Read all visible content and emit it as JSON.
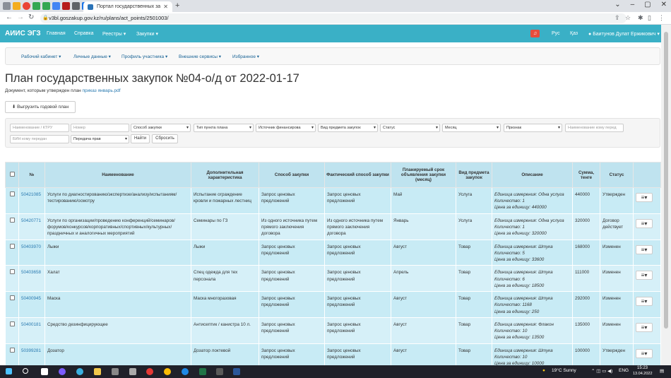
{
  "browser": {
    "tab_title": "Портал государственных закуп",
    "url": "v3bl.goszakup.gov.kz/ru/plans/act_points/2501003/"
  },
  "nav": {
    "brand": "АИИС ЭГЗ",
    "items": [
      "Главная",
      "Справка",
      "Реестры",
      "Закупки"
    ],
    "lang_ru": "Рус",
    "lang_kz": "Қаз",
    "user": "Баитунов Дулат Ержикович"
  },
  "subnav": {
    "items": [
      "Рабочий кабинет",
      "Личные данные",
      "Профиль участника",
      "Внешние сервисы",
      "Избранное"
    ]
  },
  "page": {
    "title": "План государственных закупок №04-о/д от 2022-01-17",
    "doc_label": "Документ, которым утвержден план",
    "doc_link": "приказ январь.pdf",
    "export_button": "Выгрузить годовой план"
  },
  "filters": {
    "name_placeholder": "Наименование / КТРУ",
    "number_placeholder": "Номер",
    "method": "Способ закупки",
    "point_type": "Тип пункта плана",
    "source": "Источник финансирова",
    "subject_type": "Вид предмета закупок",
    "status": "Статус",
    "month": "Месяц",
    "sign": "Признак",
    "transferred_name_placeholder": "Наименование кому перед",
    "bin_placeholder": "БИН кому передан",
    "rights_transfer": "Передача прав",
    "find_button": "Найти",
    "reset_button": "Сбросить"
  },
  "table": {
    "headers": [
      "№",
      "Наименование",
      "Дополнительная характеристика",
      "Способ закупки",
      "Фактический способ закупки",
      "Планируемый срок объявления закупки (месяц)",
      "Вид предмета закупок",
      "Описание",
      "Сумма, тенге",
      "Статус"
    ],
    "desc_labels": {
      "unit": "Единица измерения:",
      "qty": "Количество:",
      "price": "Цена за единицу:"
    },
    "rows": [
      {
        "num": "50421085",
        "name": "Услуги по диагностированию/экспертизе/анализу/испытаниям/тестированию/осмотру",
        "extra": "Испытание ограждение кровли и пожарных лестниц",
        "method": "Запрос ценовых предложений",
        "actual": "Запрос ценовых предложений",
        "month": "Май",
        "type": "Услуга",
        "unit": "Одна услуга",
        "qty": "1",
        "price": "440000",
        "sum": "440000",
        "status": "Утвержден"
      },
      {
        "num": "50420771",
        "name": "Услуги по организации/проведению конференций/семинаров/форумов/конкурсов/корпоративных/спортивных/культурных/праздничных и аналогичных мероприятий",
        "extra": "Семинары по ГЗ",
        "method": "Из одного источника путем прямого заключения договора",
        "actual": "Из одного источника путем прямого заключения договора",
        "month": "Январь",
        "type": "Услуга",
        "unit": "Одна услуга",
        "qty": "1",
        "price": "320000",
        "sum": "320000",
        "status": "Договор действует"
      },
      {
        "num": "50403970",
        "name": "Лыжи",
        "extra": "Лыжи",
        "method": "Запрос ценовых предложений",
        "actual": "Запрос ценовых предложений",
        "month": "Август",
        "type": "Товар",
        "unit": "Штука",
        "qty": "5",
        "price": "33600",
        "sum": "168000",
        "status": "Изменен"
      },
      {
        "num": "50403658",
        "name": "Халат",
        "extra": "Спец одежда для тех персонала",
        "method": "Запрос ценовых предложений",
        "actual": "Запрос ценовых предложений",
        "month": "Апрель",
        "type": "Товар",
        "unit": "Штука",
        "qty": "6",
        "price": "18500",
        "sum": "111000",
        "status": "Изменен"
      },
      {
        "num": "50400945",
        "name": "Маска",
        "extra": "Маска многоразовая",
        "method": "Запрос ценовых предложений",
        "actual": "Запрос ценовых предложений",
        "month": "Август",
        "type": "Товар",
        "unit": "Штука",
        "qty": "1168",
        "price": "250",
        "sum": "292000",
        "status": "Изменен"
      },
      {
        "num": "50400181",
        "name": "Средство дезинфицирующее",
        "extra": "Антисептик / канистра 10 л.",
        "method": "Запрос ценовых предложений",
        "actual": "Запрос ценовых предложений",
        "month": "Август",
        "type": "Товар",
        "unit": "Флакон",
        "qty": "10",
        "price": "13500",
        "sum": "135000",
        "status": "Изменен"
      },
      {
        "num": "50399281",
        "name": "Дозатор",
        "extra": "Дозатор локтевой",
        "method": "Запрос ценовых предложений",
        "actual": "Запрос ценовых предложений",
        "month": "Август",
        "type": "Товар",
        "unit": "Штука",
        "qty": "10",
        "price": "10000",
        "sum": "100000",
        "status": "Утвержден"
      }
    ]
  },
  "taskbar": {
    "weather": "19°C  Sunny",
    "lang": "ENG",
    "time": "15:23",
    "date": "13.04.2022"
  }
}
